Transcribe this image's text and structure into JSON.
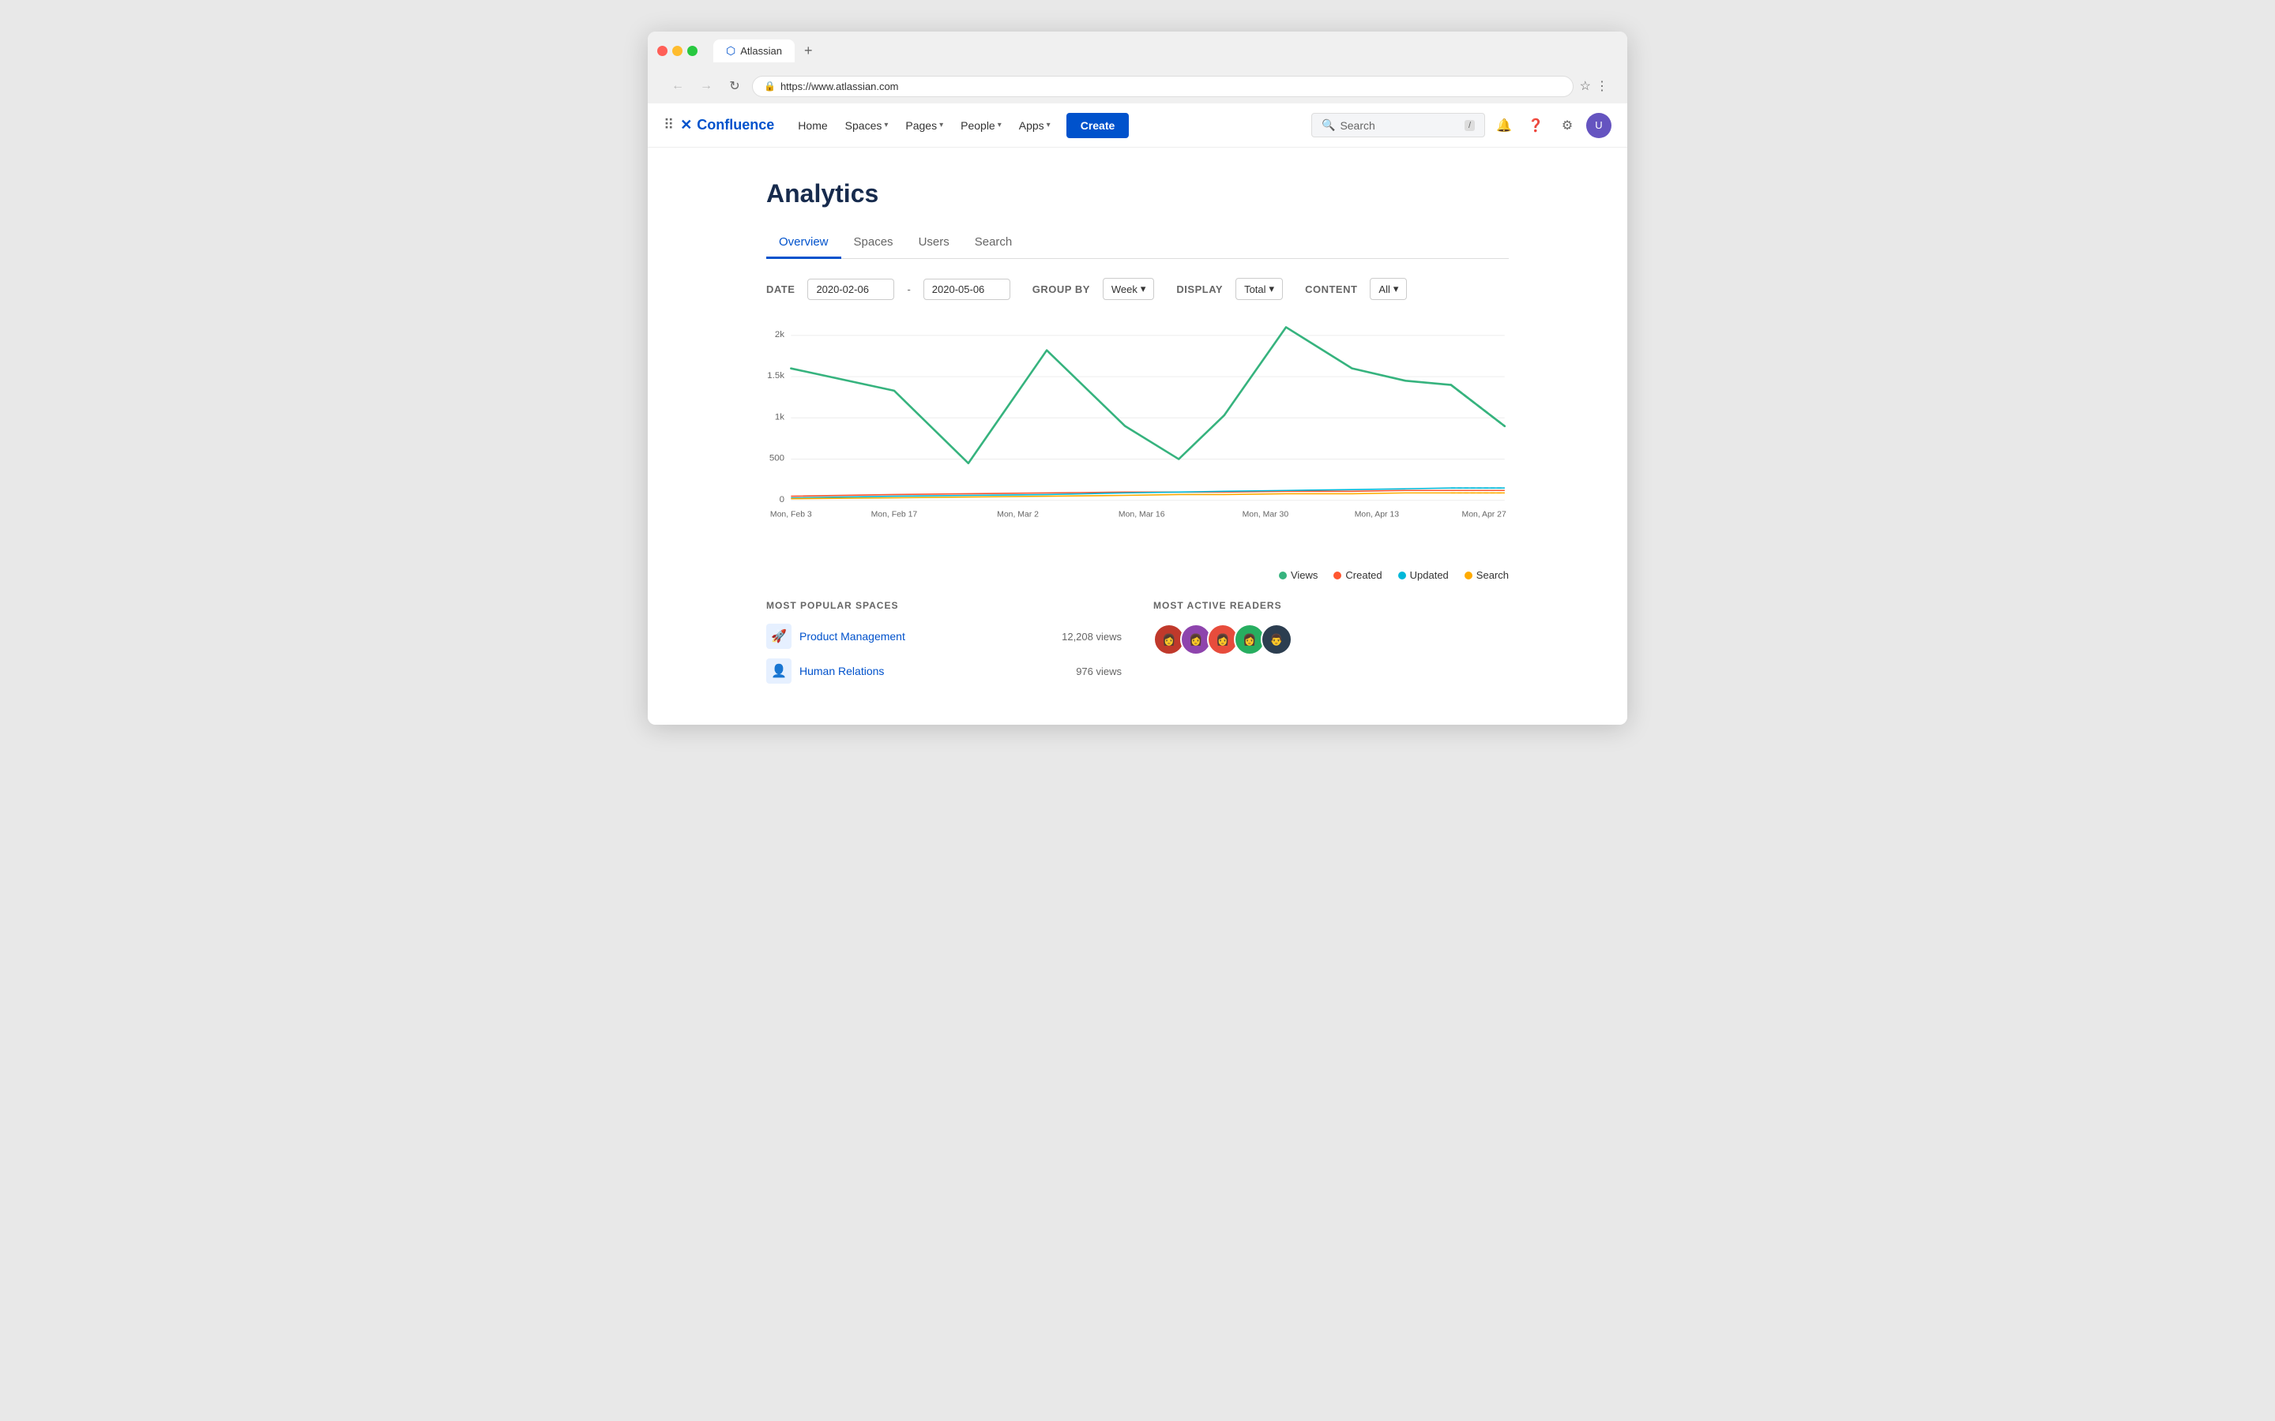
{
  "browser": {
    "tab_title": "Atlassian",
    "url": "https://www.atlassian.com",
    "new_tab_label": "+",
    "back_label": "←",
    "forward_label": "→",
    "reload_label": "↻"
  },
  "nav": {
    "logo_text": "Confluence",
    "menu_items": [
      {
        "label": "Home",
        "has_dropdown": false
      },
      {
        "label": "Spaces",
        "has_dropdown": true
      },
      {
        "label": "Pages",
        "has_dropdown": true
      },
      {
        "label": "People",
        "has_dropdown": true
      },
      {
        "label": "Apps",
        "has_dropdown": true
      }
    ],
    "create_label": "Create",
    "search_placeholder": "Search",
    "search_shortcut": "/"
  },
  "page": {
    "title": "Analytics",
    "tabs": [
      {
        "label": "Overview",
        "active": true
      },
      {
        "label": "Spaces",
        "active": false
      },
      {
        "label": "Users",
        "active": false
      },
      {
        "label": "Search",
        "active": false
      }
    ]
  },
  "filters": {
    "date_label": "DATE",
    "date_from": "2020-02-06",
    "date_to": "2020-05-06",
    "group_by_label": "GROUP BY",
    "group_by_value": "Week",
    "display_label": "DISPLAY",
    "display_value": "Total",
    "content_label": "CONTENT",
    "content_value": "All"
  },
  "chart": {
    "y_labels": [
      "2k",
      "1.5k",
      "1k",
      "500",
      "0"
    ],
    "x_labels": [
      "Mon, Feb 3",
      "Mon, Feb 17",
      "Mon, Mar 2",
      "Mon, Mar 16",
      "Mon, Mar 30",
      "Mon, Apr 13",
      "Mon, Apr 27"
    ],
    "legend": [
      {
        "label": "Views",
        "color": "#36b37e"
      },
      {
        "label": "Created",
        "color": "#ff5630"
      },
      {
        "label": "Updated",
        "color": "#00b8d9"
      },
      {
        "label": "Search",
        "color": "#ffab00"
      }
    ]
  },
  "most_popular_spaces": {
    "title": "MOST POPULAR SPACES",
    "items": [
      {
        "name": "Product Management",
        "views": "12,208 views",
        "icon": "🚀"
      },
      {
        "name": "Human Relations",
        "views": "976 views",
        "icon": "👤"
      }
    ]
  },
  "most_active_readers": {
    "title": "MOST ACTIVE READERS",
    "avatars": [
      "#e67e22",
      "#8e44ad",
      "#e74c3c",
      "#2ecc71",
      "#2c3e50"
    ]
  }
}
